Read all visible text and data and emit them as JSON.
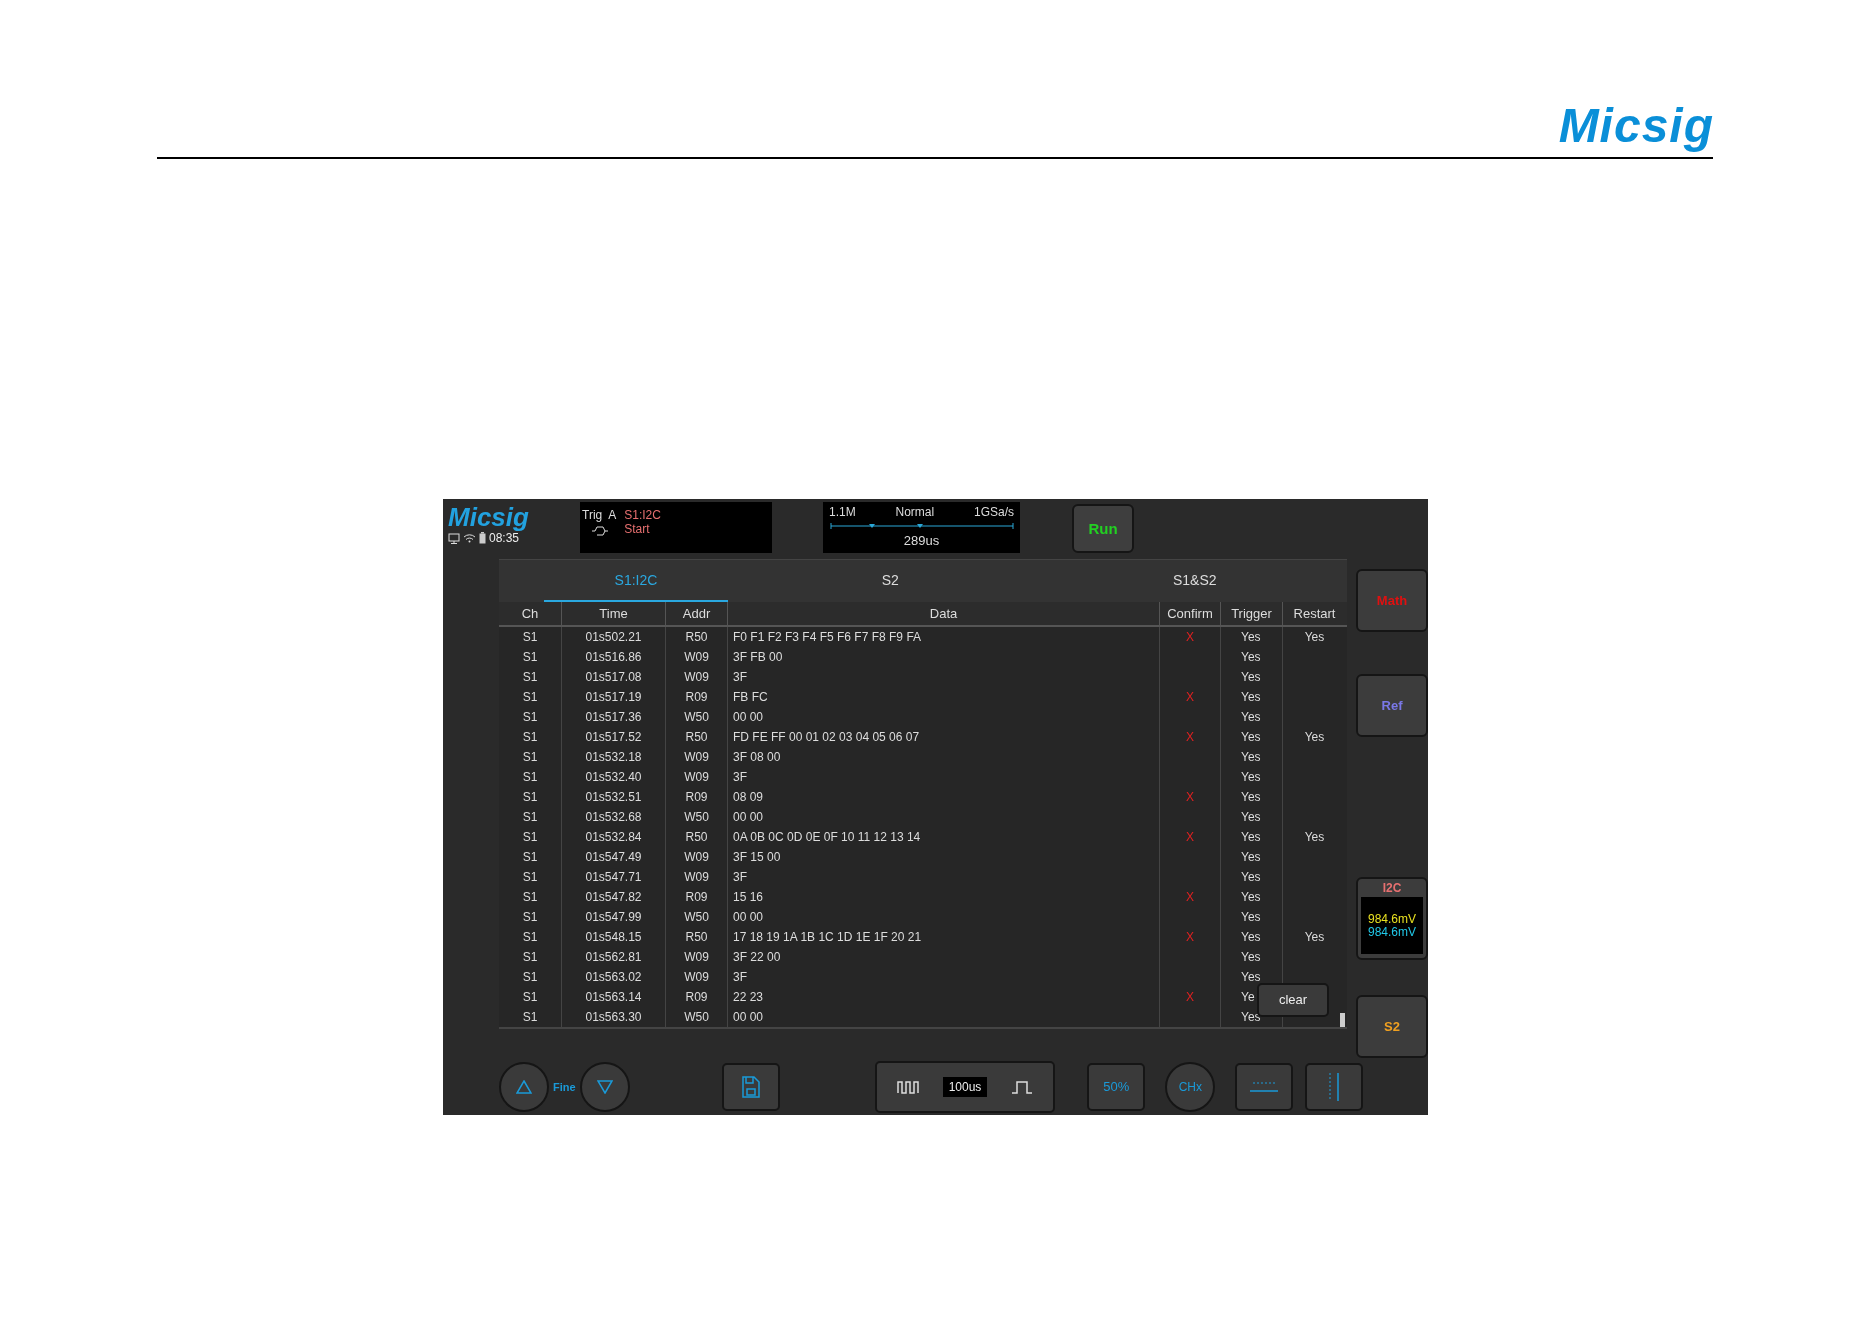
{
  "page_header": {
    "logo": "Micsig"
  },
  "scope": {
    "logo": "Micsig",
    "time": "08:35",
    "trigger": {
      "label": "Trig",
      "source": "A",
      "channel": "S1:I2C",
      "condition": "Start"
    },
    "acquisition": {
      "memory": "1.1M",
      "mode": "Normal",
      "rate": "1GSa/s",
      "position": "289us"
    },
    "run_button": "Run",
    "tabs": [
      {
        "label": "S1:I2C",
        "selected": true
      },
      {
        "label": "S2",
        "selected": false
      },
      {
        "label": "S1&S2",
        "selected": false
      }
    ],
    "table": {
      "columns": [
        "Ch",
        "Time",
        "Addr",
        "Data",
        "Confirm",
        "Trigger",
        "Restart"
      ],
      "rows": [
        {
          "ch": "S1",
          "time": "01s502.21",
          "addr": "R50",
          "data": "F0 F1 F2 F3 F4 F5 F6 F7 F8 F9 FA",
          "confirm": "X",
          "trigger": "Yes",
          "restart": "Yes"
        },
        {
          "ch": "S1",
          "time": "01s516.86",
          "addr": "W09",
          "data": "3F FB 00",
          "trigger": "Yes"
        },
        {
          "ch": "S1",
          "time": "01s517.08",
          "addr": "W09",
          "data": "3F",
          "trigger": "Yes"
        },
        {
          "ch": "S1",
          "time": "01s517.19",
          "addr": "R09",
          "data": "FB FC",
          "confirm": "X",
          "trigger": "Yes"
        },
        {
          "ch": "S1",
          "time": "01s517.36",
          "addr": "W50",
          "data": "00 00",
          "trigger": "Yes"
        },
        {
          "ch": "S1",
          "time": "01s517.52",
          "addr": "R50",
          "data": "FD FE FF 00 01 02 03 04 05 06 07",
          "confirm": "X",
          "trigger": "Yes",
          "restart": "Yes"
        },
        {
          "ch": "S1",
          "time": "01s532.18",
          "addr": "W09",
          "data": "3F 08 00",
          "trigger": "Yes"
        },
        {
          "ch": "S1",
          "time": "01s532.40",
          "addr": "W09",
          "data": "3F",
          "trigger": "Yes"
        },
        {
          "ch": "S1",
          "time": "01s532.51",
          "addr": "R09",
          "data": "08 09",
          "confirm": "X",
          "trigger": "Yes"
        },
        {
          "ch": "S1",
          "time": "01s532.68",
          "addr": "W50",
          "data": "00 00",
          "trigger": "Yes"
        },
        {
          "ch": "S1",
          "time": "01s532.84",
          "addr": "R50",
          "data": "0A 0B 0C 0D 0E 0F 10 11 12 13 14",
          "confirm": "X",
          "trigger": "Yes",
          "restart": "Yes"
        },
        {
          "ch": "S1",
          "time": "01s547.49",
          "addr": "W09",
          "data": "3F 15 00",
          "trigger": "Yes"
        },
        {
          "ch": "S1",
          "time": "01s547.71",
          "addr": "W09",
          "data": "3F",
          "trigger": "Yes"
        },
        {
          "ch": "S1",
          "time": "01s547.82",
          "addr": "R09",
          "data": "15 16",
          "confirm": "X",
          "trigger": "Yes"
        },
        {
          "ch": "S1",
          "time": "01s547.99",
          "addr": "W50",
          "data": "00 00",
          "trigger": "Yes"
        },
        {
          "ch": "S1",
          "time": "01s548.15",
          "addr": "R50",
          "data": "17 18 19 1A 1B 1C 1D 1E 1F 20 21",
          "confirm": "X",
          "trigger": "Yes",
          "restart": "Yes"
        },
        {
          "ch": "S1",
          "time": "01s562.81",
          "addr": "W09",
          "data": "3F 22 00",
          "trigger": "Yes"
        },
        {
          "ch": "S1",
          "time": "01s563.02",
          "addr": "W09",
          "data": "3F",
          "trigger": "Yes"
        },
        {
          "ch": "S1",
          "time": "01s563.14",
          "addr": "R09",
          "data": "22 23",
          "confirm": "X",
          "trigger": "Ye"
        },
        {
          "ch": "S1",
          "time": "01s563.30",
          "addr": "W50",
          "data": "00 00",
          "trigger": "Yes"
        }
      ]
    },
    "clear_button": "clear",
    "side_buttons": [
      {
        "kind": "math",
        "label": "Math"
      },
      {
        "kind": "ref",
        "label": "Ref"
      }
    ],
    "bus_panel": {
      "label": "I2C",
      "levels": [
        "984.6mV",
        "984.6mV"
      ]
    },
    "s2_button": "S2",
    "bottom": {
      "fine": "Fine",
      "timebase": "100us",
      "trigger_level": "50%",
      "channel": "CHx"
    }
  }
}
